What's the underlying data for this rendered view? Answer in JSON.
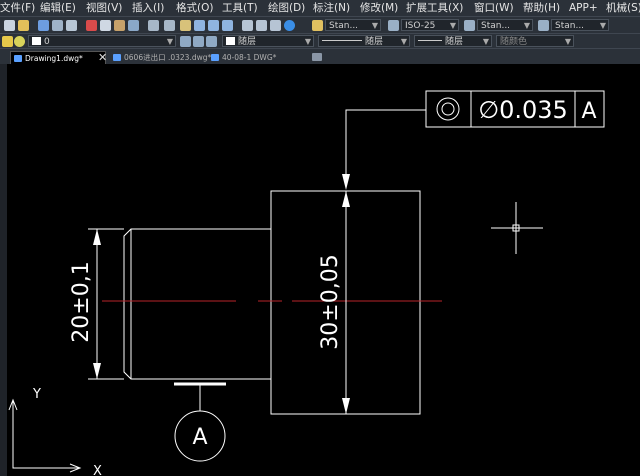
{
  "menu": [
    "文件(F)",
    "编辑(E)",
    "视图(V)",
    "插入(I)",
    "格式(O)",
    "工具(T)",
    "绘图(D)",
    "标注(N)",
    "修改(M)",
    "扩展工具(X)",
    "窗口(W)",
    "帮助(H)",
    "APP+",
    "机械(S)"
  ],
  "toolbar1": {
    "text_style": "Stan...",
    "dim_style": "ISO-25",
    "table_style": "Stan...",
    "multileader_style": "Stan..."
  },
  "toolbar2": {
    "layer": "0",
    "color": "随层",
    "linetype": "随层",
    "lineweight": "随层",
    "plot_style": "随颜色"
  },
  "tabs": [
    {
      "label": "Drawing1.dwg*",
      "active": true
    },
    {
      "label": "0606进出口 .0323.dwg*",
      "active": false
    },
    {
      "label": "40-08-1 DWG*",
      "active": false
    }
  ],
  "drawing": {
    "fcf_symbol": "◎",
    "fcf_tolerance": "∅0.035",
    "fcf_datum": "A",
    "dim_vertical_left": "20±0,1",
    "dim_vertical_right": "30±0,05",
    "datum_label": "A",
    "ucs_y": "Y",
    "ucs_x": "X"
  }
}
